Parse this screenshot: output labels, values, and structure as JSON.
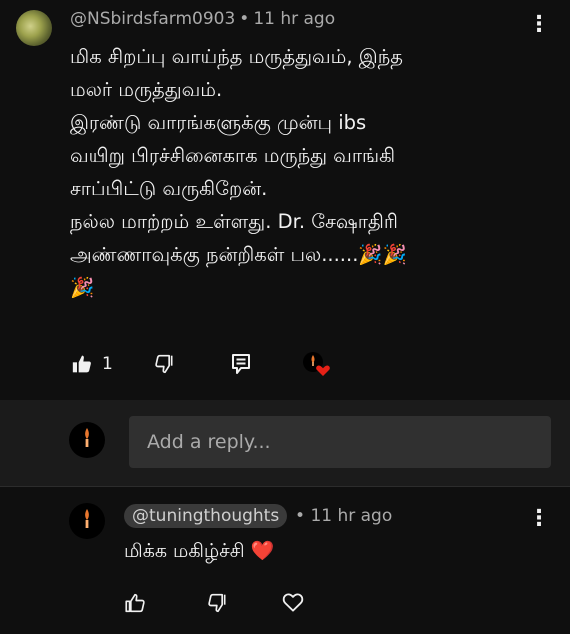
{
  "comment": {
    "author": "@NSbirdsfarm0903",
    "separator": "•",
    "time": "11 hr ago",
    "lines": [
      "மிக சிறப்பு வாய்ந்த மருத்துவம், இந்த",
      "மலர் மருத்துவம்.",
      "இரண்டு வாரங்களுக்கு முன்பு ibs",
      "வயிறு பிரச்சினைகாக மருந்து வாங்கி",
      "சாப்பிட்டு வருகிறேன்.",
      "நல்ல மாற்றம் உள்ளது. Dr. சேஷாதிரி",
      "அண்ணாவுக்கு நன்றிகள் பல......🎉🎉",
      "🎉"
    ],
    "like_count": "1",
    "more_glyph": "⋮",
    "icons": [
      "thumbs-up-icon",
      "thumbs-down-icon",
      "reply-comment-icon",
      "creator-heart-icon"
    ]
  },
  "reply_box": {
    "placeholder": "Add a reply..."
  },
  "reply": {
    "author": "@tuningthoughts",
    "separator": "•",
    "time": "11 hr ago",
    "text": "மிக்க மகிழ்ச்சி ❤️",
    "more_glyph": "⋮",
    "icons": [
      "thumbs-up-icon",
      "thumbs-down-icon",
      "heart-icon"
    ]
  },
  "colors": {
    "background": "#0f0f0f",
    "reply_bar": "#1b1b1b",
    "input": "#303030",
    "text": "#f1f1f1",
    "muted": "#aaaaaa",
    "heart": "#e62117",
    "candle": "#e8772e"
  }
}
